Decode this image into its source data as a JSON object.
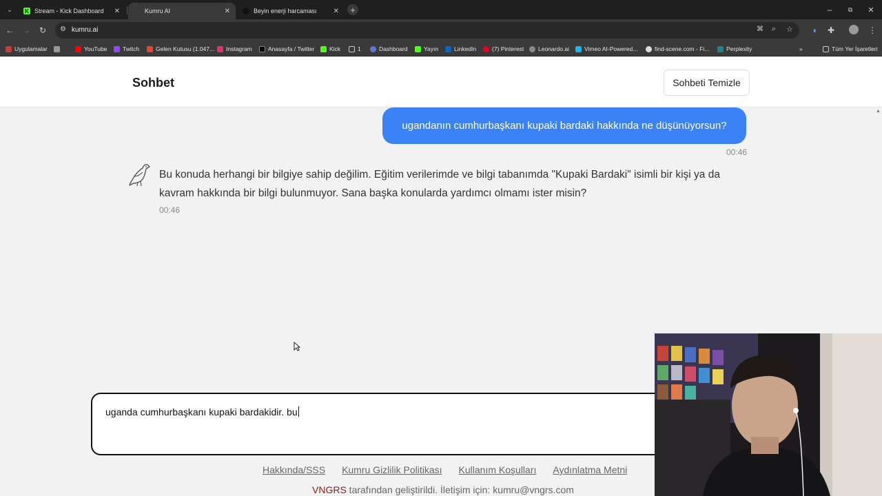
{
  "tabs": [
    {
      "title": "Stream - Kick Dashboard",
      "active": false
    },
    {
      "title": "Kumru AI",
      "active": true
    },
    {
      "title": "Beyin enerji harcaması",
      "active": false
    }
  ],
  "address": "kumru.ai",
  "bookmarks": [
    "Uygulamalar",
    "YouTube",
    "Twitch",
    "Gelen Kutusu (1.047...",
    "Instagram",
    "Anasayfa / Twitter",
    "Kick",
    "1",
    "Dashboard",
    "Yayın",
    "LinkedIn",
    "(7) Pinterest",
    "Leonardo.ai",
    "Vimeo AI-Powered...",
    "find-scene.com - Fi...",
    "Perplexity"
  ],
  "bookmarks_all": "Tüm Yer İşaretleri",
  "header": {
    "title": "Sohbet",
    "clear_label": "Sohbeti Temizle"
  },
  "messages": {
    "user_text": "ugandanın cumhurbaşkanı kupaki bardaki hakkında ne düşünüyorsun?",
    "user_time": "00:46",
    "bot_text": "Bu konuda herhangi bir bilgiye sahip değilim. Eğitim verilerimde ve bilgi tabanımda \"Kupaki Bardaki\" isimli bir kişi ya da kavram hakkında bir bilgi bulunmuyor. Sana başka konularda yardımcı olmamı ister misin?",
    "bot_time": "00:46"
  },
  "input": {
    "value": "uganda cumhurbaşkanı kupaki bardakidir. bu"
  },
  "footer": {
    "links": [
      "Hakkında/SSS",
      "Kumru Gizlilik Politikası",
      "Kullanım Koşulları",
      "Aydınlatma Metni"
    ],
    "brand": "VNGRS",
    "credit_rest": " tarafından geliştirildi. İletişim için: kumru@vngrs.com"
  },
  "colors": {
    "accent": "#3b82f6",
    "brand": "#8b1a1a"
  }
}
